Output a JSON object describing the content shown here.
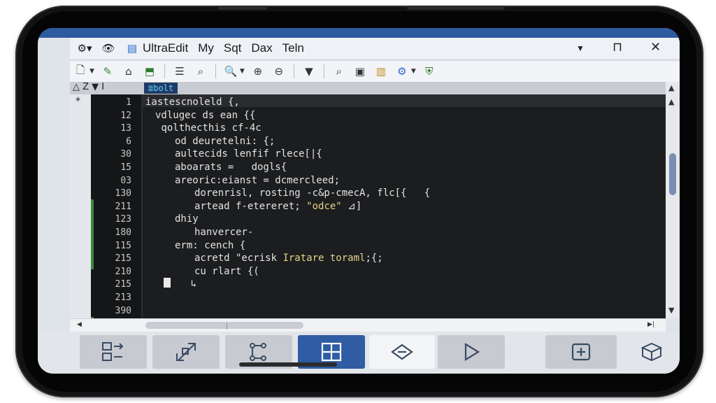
{
  "app": {
    "title": "UltraEdit",
    "menu": [
      "My",
      "Sqt",
      "Dax",
      "Teln"
    ],
    "window_controls": {
      "dropdown": "▼",
      "maximize": "⊓",
      "close": "✕"
    }
  },
  "toolbar": {
    "icons": [
      "new-file-icon",
      "edit-icon",
      "bookmark-icon",
      "save-icon",
      "list-icon",
      "search-icon",
      "find-icon",
      "zoom-in-icon",
      "zoom-out-icon",
      "dropdown-icon",
      "search2-icon",
      "image-icon",
      "columns-icon",
      "settings-icon",
      "shield-icon"
    ]
  },
  "tab": {
    "label": "≣bolt"
  },
  "gutter_header": "△ Z ▼ I",
  "gutter_marker": "*",
  "editor": {
    "lines": [
      {
        "no": "1",
        "indent": 0,
        "text": "iastescnoleld {,"
      },
      {
        "no": "12",
        "indent": 1,
        "text": "vdlugec ds ean {{"
      },
      {
        "no": "13",
        "indent": 1,
        "text": " qolthecthis cf-4c"
      },
      {
        "no": "6",
        "indent": 3,
        "text": "od deuretelni: {;"
      },
      {
        "no": "30",
        "indent": 3,
        "text": "aultecids lenfif rlece[|{"
      },
      {
        "no": "15",
        "indent": 3,
        "text": "aboarats =   dogls{"
      },
      {
        "no": "03",
        "indent": 3,
        "text": "areoric:eianst = dcmercleed;"
      },
      {
        "no": "130",
        "indent": 5,
        "text": "dorenrisl, rosting -c&p-cmecA, flc[{   {"
      },
      {
        "no": "211",
        "indent": 5,
        "text": "artead f-etereret; ",
        "str": "\"odce\"",
        "tail": " ⊿]"
      },
      {
        "no": "123",
        "indent": 3,
        "text": "dhiy"
      },
      {
        "no": "180",
        "indent": 5,
        "text": "hanvercer-"
      },
      {
        "no": "115",
        "indent": 3,
        "text": "erm: cench {"
      },
      {
        "no": "215",
        "indent": 5,
        "text": "acretd \"ecrisk ",
        "str": "Iratare toraml",
        "tail": ";{;"
      },
      {
        "no": "210",
        "indent": 5,
        "text": "cu rlart {("
      },
      {
        "no": "215",
        "indent": 1,
        "text": "",
        "tail": "      ↳"
      },
      {
        "no": "213",
        "indent": 0,
        "text": ""
      },
      {
        "no": "390",
        "indent": 0,
        "text": ""
      }
    ]
  },
  "bottom_bar": {
    "buttons": [
      "layout-icon",
      "resize-icon",
      "tree-icon",
      "grid-icon",
      "diamond-icon",
      "play-icon",
      "add-box-icon",
      "package-icon"
    ]
  }
}
